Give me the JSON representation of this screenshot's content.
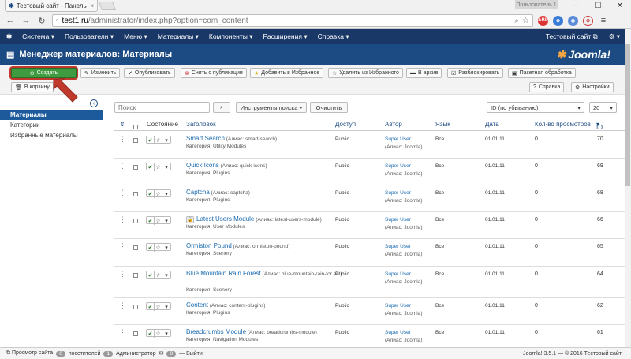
{
  "browser": {
    "tab_title": "Тестовый сайт - Панель",
    "tab_close": "×",
    "user_badge": "Пользователь 1",
    "url_host": "test1.ru",
    "url_path": "/administrator/index.php?option=com_content",
    "ext_abp": "ABP"
  },
  "navbar": {
    "menu": [
      "Система",
      "Пользователи",
      "Меню",
      "Материалы",
      "Компоненты",
      "Расширения",
      "Справка"
    ],
    "site_link": "Тестовый сайт"
  },
  "header": {
    "title": "Менеджер материалов: Материалы",
    "logo": "Joomla!"
  },
  "toolbar": {
    "create": "Создать",
    "edit": "Изменить",
    "publish": "Опубликовать",
    "unpublish": "Снять с публикации",
    "feature": "Добавить в Избранное",
    "unfeature": "Удалить из Избранного",
    "archive": "В архив",
    "checkin": "Разблокировать",
    "batch": "Пакетная обработка",
    "trash": "В корзину",
    "help": "Справка",
    "options": "Настройки"
  },
  "sidebar": {
    "items": [
      {
        "label": "Материалы",
        "active": true
      },
      {
        "label": "Категории",
        "active": false
      },
      {
        "label": "Избранные материалы",
        "active": false
      }
    ]
  },
  "filters": {
    "search_placeholder": "Поиск",
    "search_tools": "Инструменты поиска",
    "clear": "Очистить",
    "ordering": "ID (по убыванию)",
    "limit": "20"
  },
  "table": {
    "headers": {
      "status": "Состояние",
      "title": "Заголовок",
      "access": "Доступ",
      "author": "Автор",
      "language": "Язык",
      "date": "Дата",
      "hits": "Кол-во просмотров",
      "id": "ID"
    },
    "rows": [
      {
        "title": "Smart Search",
        "alias": "(Алиас: smart-search)",
        "category": "Категория: Utility Modules",
        "access": "Public",
        "author": "Super User",
        "author_alias": "(Алиас: Joomla)",
        "language": "Все",
        "date": "01.01.11",
        "hits": "0",
        "id": "70",
        "locked": false
      },
      {
        "title": "Quick Icons",
        "alias": "(Алиас: quick-icons)",
        "category": "Категория: Plugins",
        "access": "Public",
        "author": "Super User",
        "author_alias": "(Алиас: Joomla)",
        "language": "Все",
        "date": "01.01.11",
        "hits": "0",
        "id": "69",
        "locked": false
      },
      {
        "title": "Captcha",
        "alias": "(Алиас: captcha)",
        "category": "Категория: Plugins",
        "access": "Public",
        "author": "Super User",
        "author_alias": "(Алиас: Joomla)",
        "language": "Все",
        "date": "01.01.11",
        "hits": "0",
        "id": "68",
        "locked": false
      },
      {
        "title": "Latest Users Module",
        "alias": "(Алиас: latest-users-module)",
        "category": "Категория: User Modules",
        "access": "Public",
        "author": "Super User",
        "author_alias": "(Алиас: Joomla)",
        "language": "Все",
        "date": "01.01.11",
        "hits": "0",
        "id": "66",
        "locked": true
      },
      {
        "title": "Ormiston Pound",
        "alias": "(Алиас: ormiston-pound)",
        "category": "Категория: Scenery",
        "access": "Public",
        "author": "Super User",
        "author_alias": "(Алиас: Joomla)",
        "language": "Все",
        "date": "01.01.11",
        "hits": "0",
        "id": "65",
        "locked": false
      },
      {
        "title": "Blue Mountain Rain Forest",
        "alias": "(Алиас: blue-mountain-rain-for est)",
        "category": "Категория: Scenery",
        "access": "Public",
        "author": "Super User",
        "author_alias": "(Алиас: Joomla)",
        "language": "Все",
        "date": "01.01.11",
        "hits": "0",
        "id": "64",
        "locked": false
      },
      {
        "title": "Content",
        "alias": "(Алиас: content-plugins)",
        "category": "Категория: Plugins",
        "access": "Public",
        "author": "Super User",
        "author_alias": "(Алиас: Joomla)",
        "language": "Все",
        "date": "01.01.11",
        "hits": "0",
        "id": "62",
        "locked": false
      },
      {
        "title": "Breadcrumbs Module",
        "alias": "(Алиас: breadcrumbs-module)",
        "category": "Категория: Navigation Modules",
        "access": "Public",
        "author": "Super User",
        "author_alias": "(Алиас: Joomla)",
        "language": "Все",
        "date": "01.01.11",
        "hits": "0",
        "id": "61",
        "locked": false
      }
    ]
  },
  "footer": {
    "view_site": "Просмотр сайта",
    "visitors_count": "0",
    "visitors_label": "посетителей",
    "admins_count": "1",
    "admins_label": "Администратор",
    "messages_count": "0",
    "logout": "Выйти",
    "version": "Joomla! 3.5.1 — © 2016 Тестовый сайт"
  },
  "colors": {
    "navbar": "#1a3867",
    "header": "#1c4a82",
    "create_button": "#3f9b3f",
    "link": "#1a6bb0",
    "highlight": "#c0392b"
  }
}
